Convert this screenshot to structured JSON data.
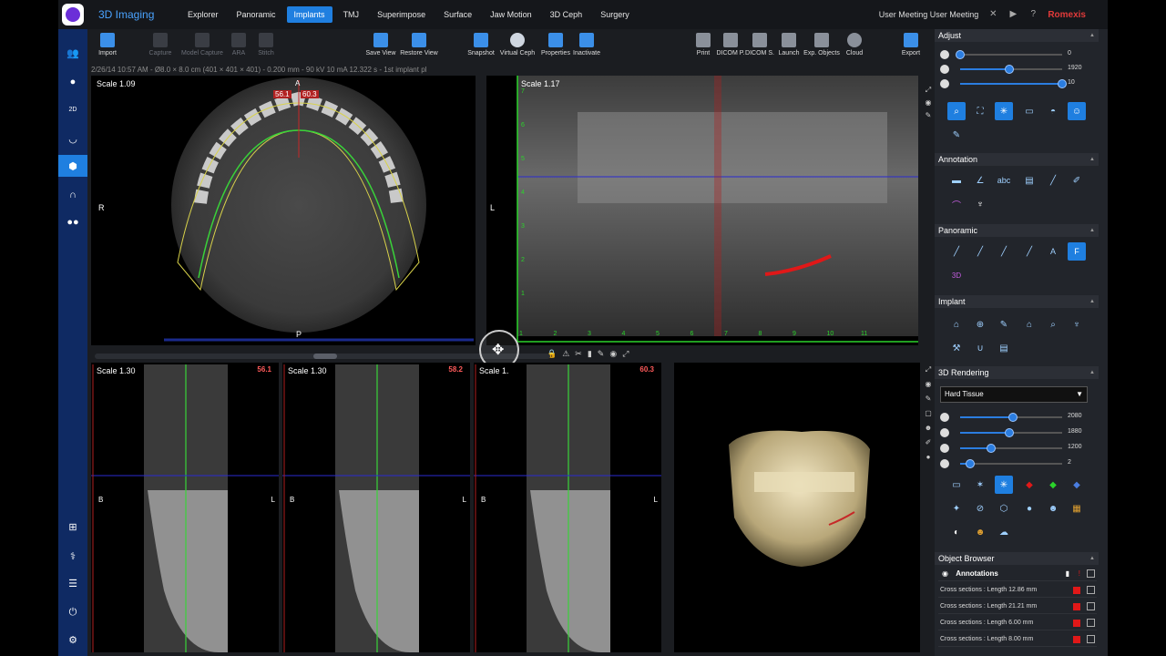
{
  "app": {
    "title": "3D Imaging",
    "brand": "Romexis",
    "user": "User Meeting User Meeting"
  },
  "menu": [
    "Explorer",
    "Panoramic",
    "Implants",
    "TMJ",
    "Superimpose",
    "Surface",
    "Jaw Motion",
    "3D Ceph",
    "Surgery"
  ],
  "menu_active": "Implants",
  "toolbar": {
    "left": [
      {
        "label": "Import",
        "icon": "import-icon",
        "enabled": true
      },
      {
        "label": "Capture",
        "icon": "capture-icon",
        "enabled": false
      },
      {
        "label": "Model Capture",
        "icon": "model-capture-icon",
        "enabled": false
      },
      {
        "label": "ARA",
        "icon": "ara-icon",
        "enabled": false
      },
      {
        "label": "Stitch",
        "icon": "stitch-icon",
        "enabled": false
      }
    ],
    "middle": [
      {
        "label": "Save View",
        "icon": "save-view-icon"
      },
      {
        "label": "Restore View",
        "icon": "restore-view-icon"
      },
      {
        "label": "Snapshot",
        "icon": "snapshot-icon"
      },
      {
        "label": "Virtual Ceph",
        "icon": "virtual-ceph-icon"
      },
      {
        "label": "Properties",
        "icon": "properties-icon"
      },
      {
        "label": "Inactivate",
        "icon": "inactivate-icon"
      }
    ],
    "right": [
      {
        "label": "Print",
        "icon": "print-icon"
      },
      {
        "label": "DICOM P.",
        "icon": "dicom-p-icon"
      },
      {
        "label": "DICOM S.",
        "icon": "dicom-s-icon"
      },
      {
        "label": "Launch",
        "icon": "launch-icon"
      },
      {
        "label": "Exp. Objects",
        "icon": "export-objects-icon"
      },
      {
        "label": "Cloud",
        "icon": "cloud-icon"
      },
      {
        "label": "Export",
        "icon": "export-icon"
      }
    ]
  },
  "info_line": "2/26/14 10:57 AM - Ø8.0 × 8.0 cm (401 × 401 × 401) - 0.200 mm - 90 kV 10 mA 12.322 s - 1st implant pl",
  "axial": {
    "scale": "Scale 1.09",
    "angle": "56.1",
    "angle2": "60.3",
    "label_a": "A",
    "label_p": "P",
    "label_r": "R"
  },
  "panoramic": {
    "scale": "Scale 1.17",
    "label_l": "L",
    "ruler": [
      "1",
      "2",
      "3",
      "4",
      "5",
      "6",
      "7",
      "8",
      "9",
      "10",
      "11"
    ],
    "vruler": [
      "7",
      "6",
      "5",
      "4",
      "3",
      "2",
      "1"
    ]
  },
  "cross_sections": [
    {
      "scale": "Scale 1.30",
      "value": "56.1",
      "label_b": "B",
      "label_l": "L"
    },
    {
      "scale": "Scale 1.30",
      "value": "58.2",
      "label_b": "B",
      "label_l": "L"
    },
    {
      "scale": "Scale 1.",
      "value": "60.3",
      "label_b": "B",
      "label_l": "L"
    }
  ],
  "right_panel": {
    "adjust": {
      "title": "Adjust",
      "values": [
        "0",
        "1920",
        "10"
      ],
      "levels": [
        0.0,
        0.48,
        1.0
      ]
    },
    "annotation": {
      "title": "Annotation",
      "abc": "abc"
    },
    "panoramic": {
      "title": "Panoramic",
      "label3d": "3D",
      "letterA": "A",
      "letterF": "F"
    },
    "implant": {
      "title": "Implant"
    },
    "rendering": {
      "title": "3D Rendering",
      "preset": "Hard Tissue",
      "values": [
        "2080",
        "1880",
        "1200",
        "2"
      ],
      "levels": [
        0.52,
        0.48,
        0.3,
        0.1
      ]
    },
    "object_browser": {
      "title": "Object Browser",
      "group": "Annotations",
      "items": [
        "Cross sections : Length 12.86 mm",
        "Cross sections : Length 21.21 mm",
        "Cross sections : Length 6.00 mm",
        "Cross sections : Length 8.00 mm"
      ]
    }
  },
  "colors": {
    "accent": "#1f7fe0",
    "brand": "#e23a3a",
    "sidebar": "#0f2a63",
    "ruler": "#2bd32b"
  }
}
